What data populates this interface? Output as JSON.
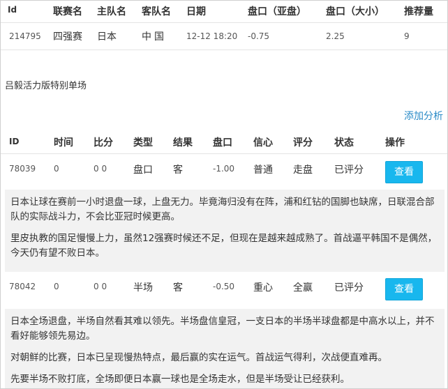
{
  "match_table": {
    "headers": [
      "Id",
      "联赛名",
      "主队名",
      "客队名",
      "日期",
      "盘口（亚盘）",
      "盘口（大小）",
      "推荐量"
    ],
    "row": [
      "214795",
      "四强赛",
      "日本",
      "中国",
      "12-12 18:20",
      "-0.75",
      "2.25",
      "9"
    ]
  },
  "promo_text": "吕毅活力版特别单场",
  "add_analysis_label": "添加分析",
  "analysis_table": {
    "headers": [
      "ID",
      "时间",
      "比分",
      "类型",
      "结果",
      "盘口",
      "信心",
      "评分",
      "状态",
      "操作"
    ],
    "rows": [
      {
        "cells": [
          "78039",
          "0",
          "0 0",
          "盘口",
          "客",
          "-1.00",
          "普通",
          "走盘",
          "已评分"
        ],
        "button": "查看",
        "paragraphs": [
          "日本让球在赛前一小时退盘一球，上盘无力。毕竟海归没有在阵，浦和红钻的国脚也缺席，日联混合部队的实际战斗力，不会比亚冠时候更高。",
          "里皮执教的国足慢慢上力，虽然12强赛时候还不足，但现在是越来越成熟了。首战逼平韩国不是偶然，今天仍有望不败日本。"
        ]
      },
      {
        "cells": [
          "78042",
          "0",
          "0 0",
          "半场",
          "客",
          "-0.50",
          "重心",
          "全赢",
          "已评分"
        ],
        "button": "查看",
        "paragraphs": [
          "日本全场退盘，半场自然看其难以领先。半场盘信皇冠，一支日本的半场半球盘都是中高水以上，并不看好能够领先易边。",
          "对朝鲜的比赛，日本已呈现慢热特点，最后赢的实在运气。首战运气得利，次战便直难再。",
          "先要半场不败打底，全场即便日本赢一球也是全场走水，但是半场受让已经获利。"
        ]
      }
    ]
  }
}
